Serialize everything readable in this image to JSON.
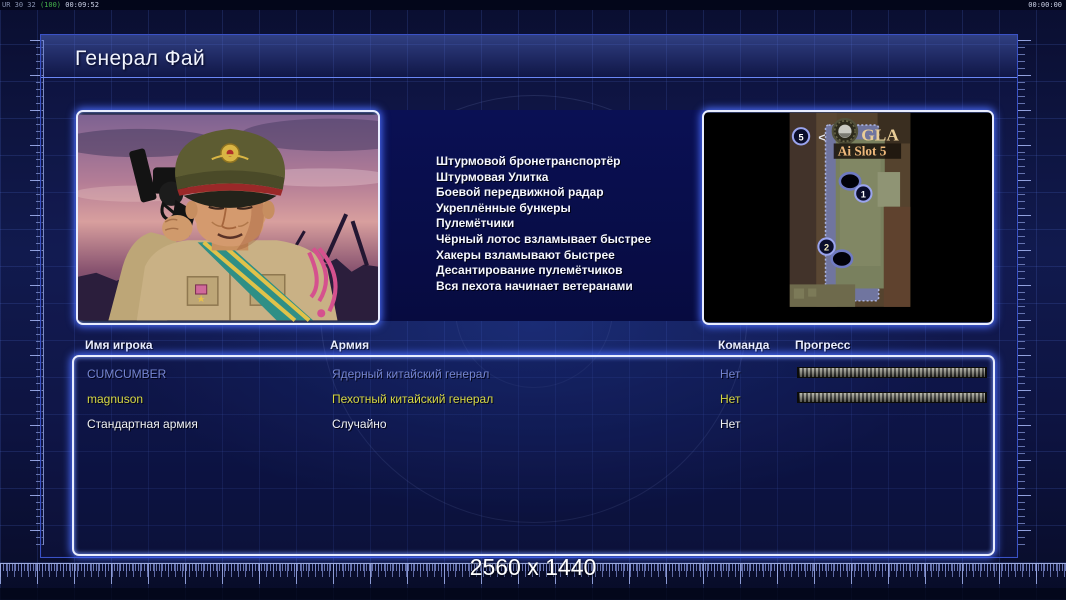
{
  "hud": {
    "debug_counters": "UR 30 32",
    "debug_fps": "(100)",
    "debug_time": "00:09:52",
    "clock": "00:00:00"
  },
  "title": "Генерал Фай",
  "abilities": [
    "Штурмовой бронетранспортёр",
    "Штурмовая Улитка",
    "Боевой передвижной радар",
    "Укреплённые бункеры",
    "Пулемётчики",
    "Чёрный лотос взламывает быстрее",
    "Хакеры взламывают быстрее",
    "Десантирование пулемётчиков",
    "Вся пехота начинает ветеранами"
  ],
  "minimap": {
    "faction_label": "GLA",
    "slot_label": "Ai Slot 5",
    "back_arrow": "<",
    "badge_5": "5",
    "badge_1": "1",
    "badge_2": "2"
  },
  "table": {
    "headers": [
      "Имя игрока",
      "Армия",
      "Команда",
      "Прогресс"
    ],
    "rows": [
      {
        "name": "CUMCUMBER",
        "army": "Ядерный китайский генерал",
        "team": "Нет",
        "color": "#7585cf",
        "has_progress": true
      },
      {
        "name": "magnuson",
        "army": "Пехотный китайский генерал",
        "team": "Нет",
        "color": "#d6d743",
        "has_progress": true
      },
      {
        "name": "Стандартная армия",
        "army": "Случайно",
        "team": "Нет",
        "color": "#f0f2f5",
        "has_progress": false
      }
    ]
  },
  "footer": {
    "resolution": "2560 x 1440"
  },
  "colors": {
    "background": "#0b1034",
    "grid_line": "#39539e",
    "panel_border": "#3a52c6",
    "glow_border": "#e8edff",
    "glow": "#4b6eff",
    "slot_text": "#efb97c",
    "gla_text": "#e9cd97",
    "progress_segment": "#9b9b8d"
  }
}
